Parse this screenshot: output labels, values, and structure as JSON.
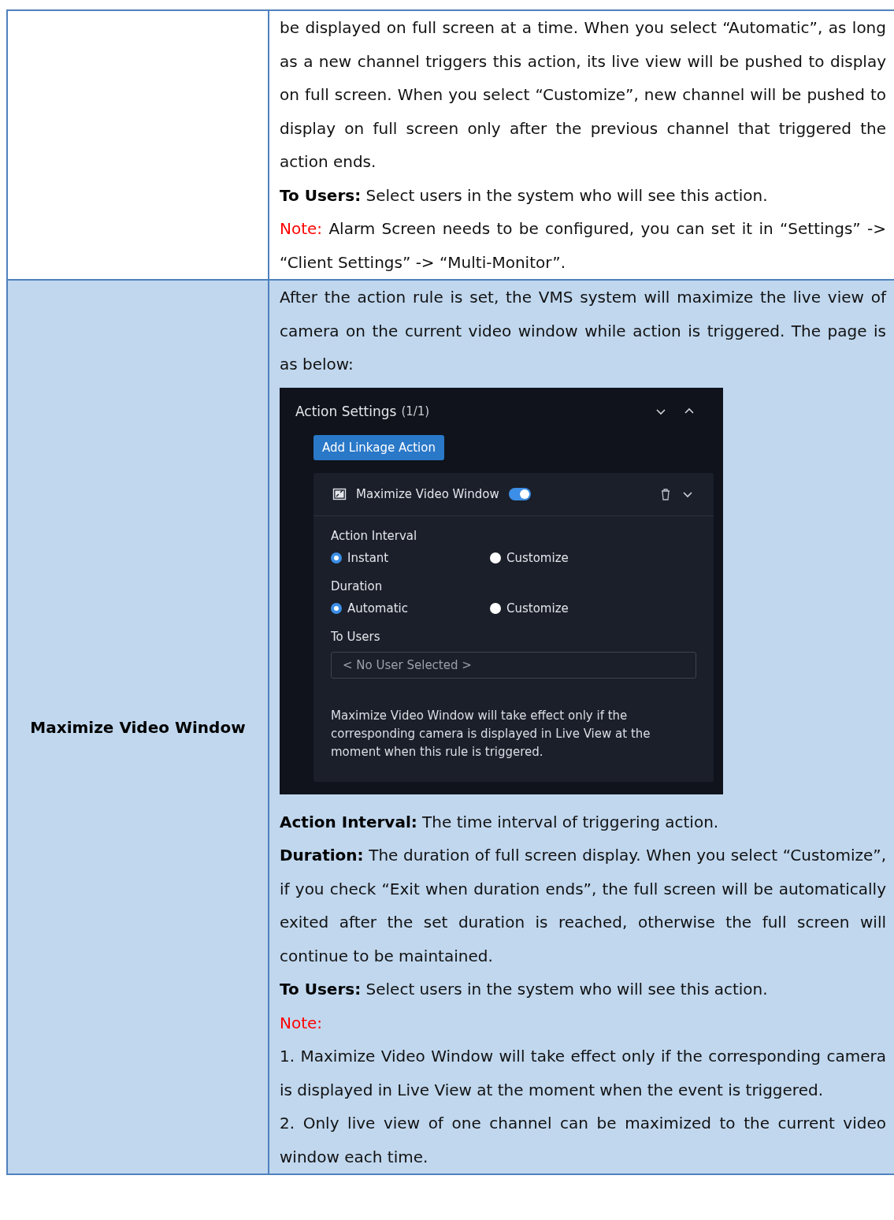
{
  "rows": [
    {
      "content": [
        {
          "kind": "text",
          "text": "be displayed on full screen at a time. When you select “Automatic”, as long as a new channel triggers this action, its live view will be pushed to display on full screen. When you select “Customize”, new channel will be pushed to display on full screen only after the previous channel that triggered the action ends."
        },
        {
          "kind": "labeled",
          "label": "To Users:",
          "text": "Select users in the system who will see this action."
        },
        {
          "kind": "note",
          "label": "Note:",
          "text": "Alarm Screen needs to be configured, you can set it in “Settings” -> “Client Settings” -> “Multi-Monitor”."
        }
      ]
    },
    {
      "heading": "Maximize Video Window",
      "content": [
        {
          "kind": "text",
          "text": "After the action rule is set, the VMS system will maximize the live view of camera on the current video window while action is triggered. The page is as below:"
        },
        {
          "kind": "screenshot",
          "title": "Action Settings",
          "count": "(1/1)",
          "add_button": "Add Linkage Action",
          "action": {
            "name": "Maximize Video Window",
            "on": true
          },
          "groups": [
            {
              "label": "Action Interval",
              "options": [
                {
                  "label": "Instant",
                  "selected": true
                },
                {
                  "label": "Customize",
                  "selected": false
                }
              ]
            },
            {
              "label": "Duration",
              "options": [
                {
                  "label": "Automatic",
                  "selected": true
                },
                {
                  "label": "Customize",
                  "selected": false
                }
              ]
            }
          ],
          "users_label": "To Users",
          "users_placeholder": "< No User Selected >",
          "hint": "Maximize Video Window will take effect only if the corresponding camera is displayed in Live View at the moment when this rule is triggered."
        },
        {
          "kind": "labeled",
          "label": "Action Interval:",
          "text": "The time interval of triggering action."
        },
        {
          "kind": "labeled",
          "label": "Duration:",
          "text": "The duration of full screen display. When you select “Customize”, if you check “Exit when duration ends”, the full screen will be automatically exited after the set duration is reached, otherwise the full screen will continue to be maintained."
        },
        {
          "kind": "labeled",
          "label": "To Users:",
          "text": "Select users in the system who will see this action."
        },
        {
          "kind": "note",
          "label": "Note:"
        },
        {
          "kind": "text",
          "text": "1. Maximize Video Window will take effect only if the corresponding camera is displayed in Live View at the moment when the event is triggered."
        },
        {
          "kind": "text",
          "text": "2. Only live view of one channel can be maximized to the current video window each time."
        }
      ]
    }
  ]
}
